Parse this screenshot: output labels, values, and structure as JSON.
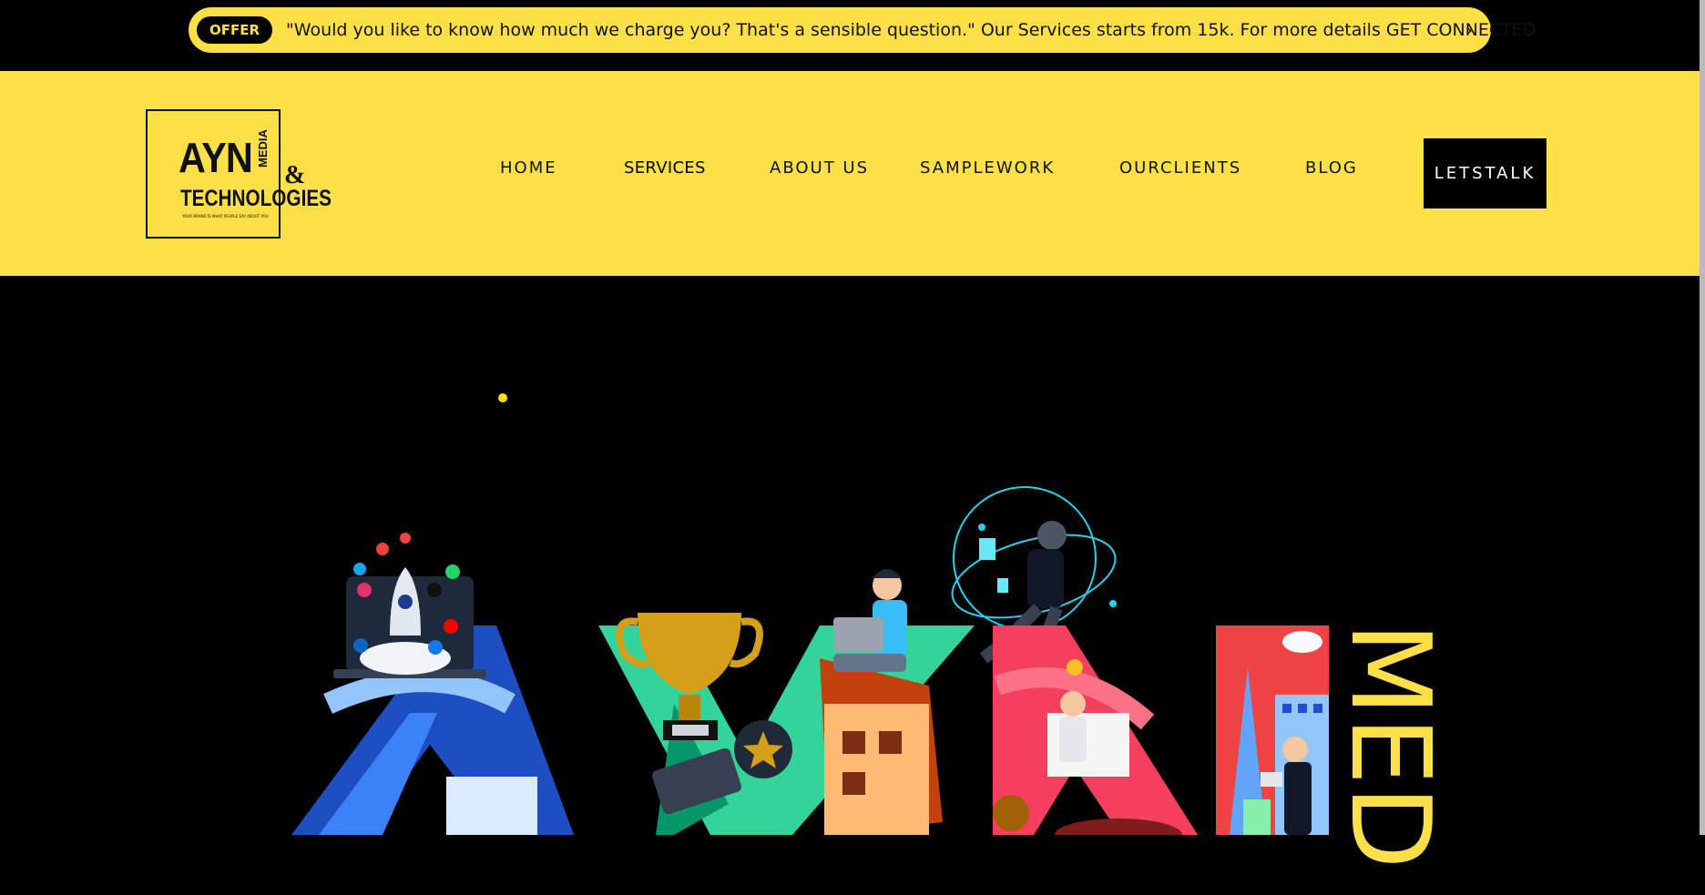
{
  "offer": {
    "badge": "OFFER",
    "text": "\"Would you like to know how much we charge you? That's a sensible question.\" Our Services starts from 15k. For more details GET CONNECTED",
    "chevron": "›"
  },
  "logo": {
    "main": "AYN",
    "media": "MEDIA",
    "amp": "&",
    "technologies": "TECHNOLOGIES",
    "tagline": "YOUR BRAND IS WHAT PEOPLE SAY ABOUT YOU"
  },
  "nav": [
    {
      "label": "HOME"
    },
    {
      "label": "SERVICES"
    },
    {
      "label": "ABOUT US"
    },
    {
      "label": "SAMPLEWORK"
    },
    {
      "label": "OURCLIENTS"
    },
    {
      "label": "BLOG"
    }
  ],
  "cta": {
    "label": "LETSTALK"
  },
  "hero": {
    "side_text": "MED"
  },
  "colors": {
    "brand_yellow": "#fde047",
    "offer_yellow": "#fde046",
    "background": "#000000"
  }
}
